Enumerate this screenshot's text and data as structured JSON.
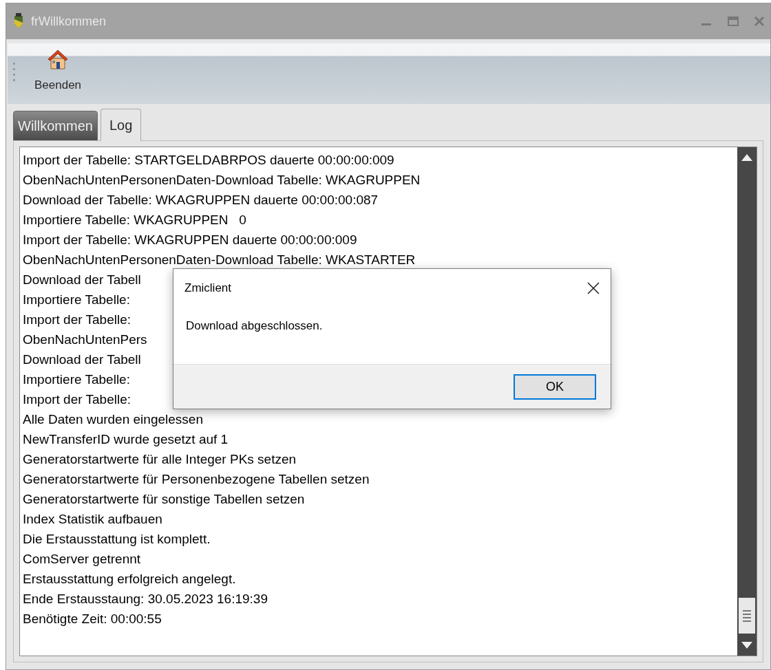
{
  "window": {
    "title": "frWillkommen"
  },
  "toolbar": {
    "buttons": [
      {
        "label": "Beenden"
      }
    ]
  },
  "tabs": [
    {
      "label": "Willkommen",
      "selected": false
    },
    {
      "label": "Log",
      "selected": true
    }
  ],
  "log": {
    "lines": [
      "Import der Tabelle: STARTGELDABRPOS dauerte 00:00:00:009",
      "ObenNachUntenPersonenDaten-Download Tabelle: WKAGRUPPEN",
      "Download der Tabelle: WKAGRUPPEN dauerte 00:00:00:087",
      "Importiere Tabelle: WKAGRUPPEN   0",
      "Import der Tabelle: WKAGRUPPEN dauerte 00:00:00:009",
      "ObenNachUntenPersonenDaten-Download Tabelle: WKASTARTER",
      "Download der Tabell",
      "Importiere Tabelle:",
      "Import der Tabelle:",
      "ObenNachUntenPers",
      "Download der Tabell",
      "Importiere Tabelle:",
      "Import der Tabelle:",
      "Alle Daten wurden eingelessen",
      "NewTransferID wurde gesetzt auf 1",
      "Generatorstartwerte für alle Integer PKs setzen",
      "Generatorstartwerte für Personenbezogene Tabellen setzen",
      "Generatorstartwerte für sonstige Tabellen setzen",
      "Index Statistik aufbauen",
      "Die Erstausstattung ist komplett.",
      "ComServer getrennt",
      "Erstausstattung erfolgreich angelegt.",
      "Ende Erstausstaung: 30.05.2023 16:19:39",
      "Benötigte Zeit: 00:00:55"
    ]
  },
  "dialog": {
    "title": "Zmiclient",
    "message": "Download abgeschlossen.",
    "buttons": [
      "OK"
    ]
  }
}
